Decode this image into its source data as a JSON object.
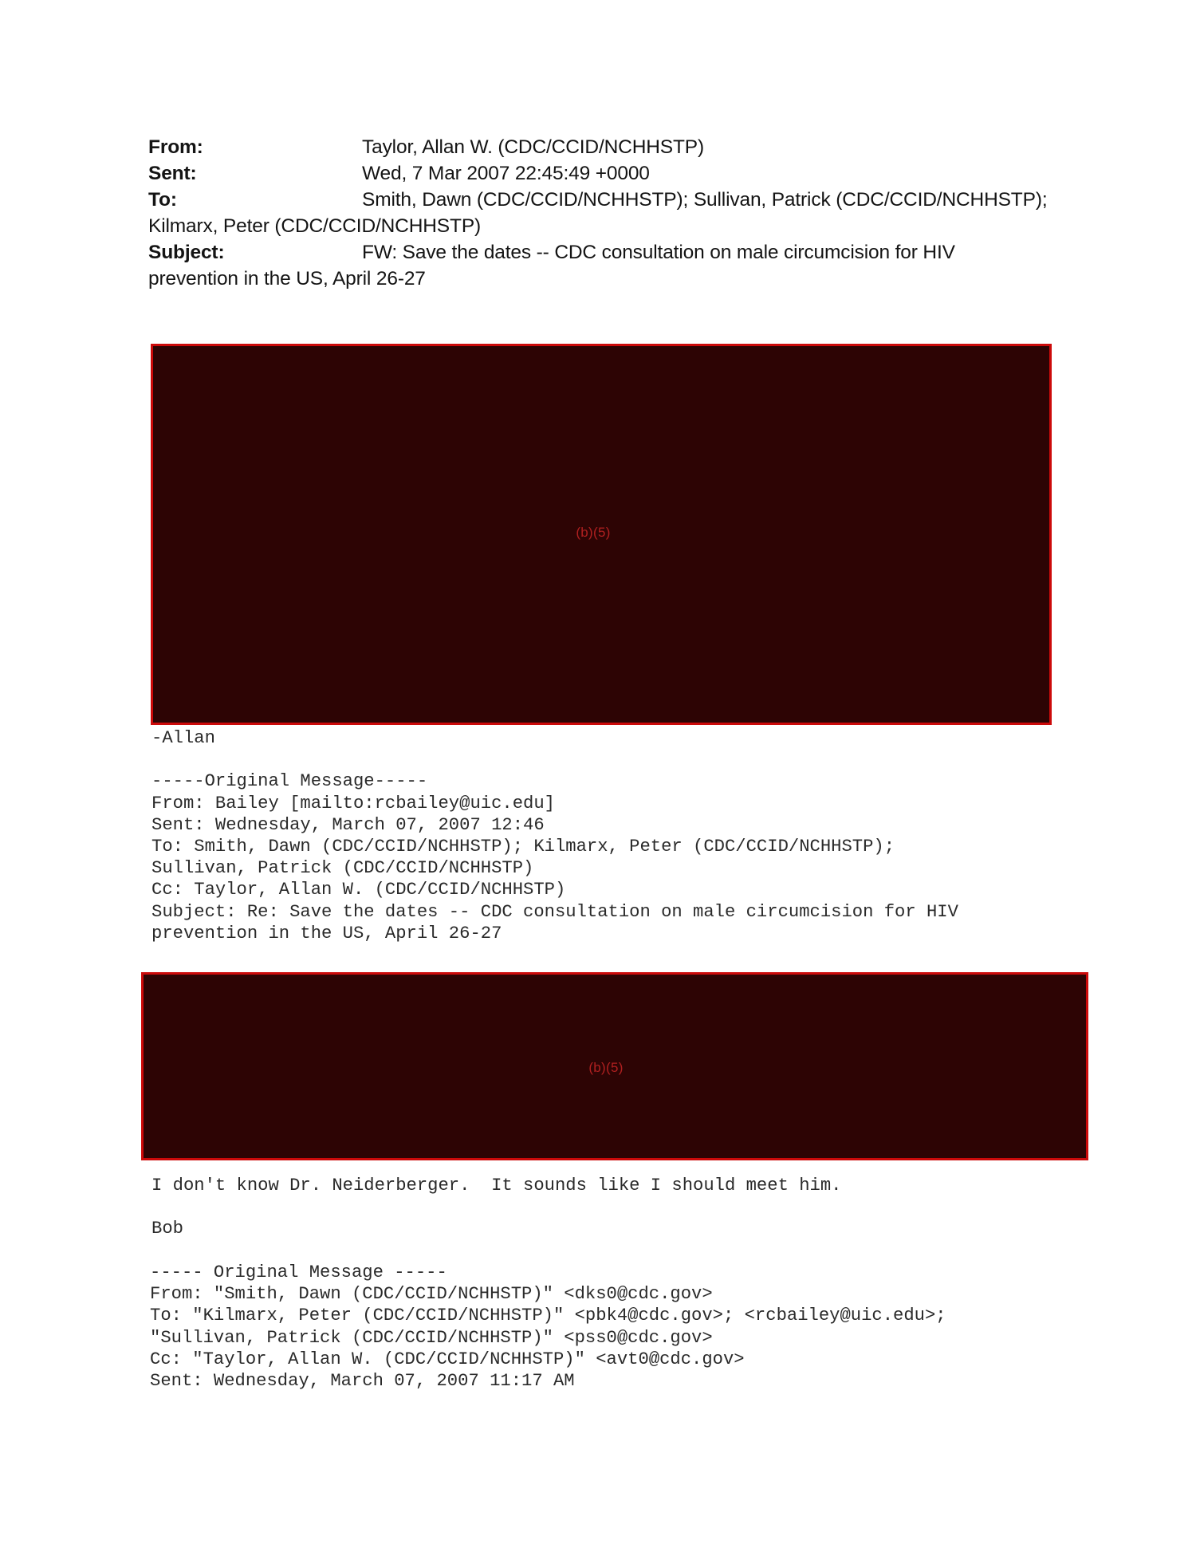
{
  "document": {
    "type": "redacted-email-printout"
  },
  "email_header": {
    "fields": [
      {
        "label": "From:",
        "value": "Taylor, Allan W. (CDC/CCID/NCHHSTP)"
      },
      {
        "label": "Sent:",
        "value": "Wed, 7 Mar 2007 22:45:49 +0000"
      },
      {
        "label": "To:",
        "value": "Smith, Dawn (CDC/CCID/NCHHSTP); Sullivan, Patrick (CDC/CCID/NCHHSTP);"
      }
    ],
    "to_continuation": "Kilmarx, Peter (CDC/CCID/NCHHSTP)",
    "subject_label": "Subject:",
    "subject_value": "FW: Save the dates -- CDC consultation on male circumcision for HIV",
    "subject_continuation": "prevention in the US, April 26-27"
  },
  "redactions": [
    {
      "id": "redaction-1",
      "label": "(b)(5)",
      "exemption_code": "(b)(5)"
    },
    {
      "id": "redaction-2",
      "label": "(b)(5)",
      "exemption_code": "(b)(5)"
    }
  ],
  "colors": {
    "redaction_fill": "#2d0404",
    "redaction_border": "#cc0a0a",
    "redaction_label": "#b02020",
    "page_background": "#ffffff",
    "body_text": "#2a2a2a"
  },
  "body_blocks": {
    "signature_and_first_quote": "-Allan\n\n-----Original Message-----\nFrom: Bailey [mailto:rcbailey@uic.edu]\nSent: Wednesday, March 07, 2007 12:46\nTo: Smith, Dawn (CDC/CCID/NCHHSTP); Kilmarx, Peter (CDC/CCID/NCHHSTP);\nSullivan, Patrick (CDC/CCID/NCHHSTP)\nCc: Taylor, Allan W. (CDC/CCID/NCHHSTP)\nSubject: Re: Save the dates -- CDC consultation on male circumcision for HIV\nprevention in the US, April 26-27",
    "reply_text": "I don't know Dr. Neiderberger.  It sounds like I should meet him.\n\nBob",
    "second_quote_header": "----- Original Message -----\nFrom: \"Smith, Dawn (CDC/CCID/NCHHSTP)\" <dks0@cdc.gov>\nTo: \"Kilmarx, Peter (CDC/CCID/NCHHSTP)\" <pbk4@cdc.gov>; <rcbailey@uic.edu>;\n\"Sullivan, Patrick (CDC/CCID/NCHHSTP)\" <pss0@cdc.gov>\nCc: \"Taylor, Allan W. (CDC/CCID/NCHHSTP)\" <avt0@cdc.gov>\nSent: Wednesday, March 07, 2007 11:17 AM"
  }
}
